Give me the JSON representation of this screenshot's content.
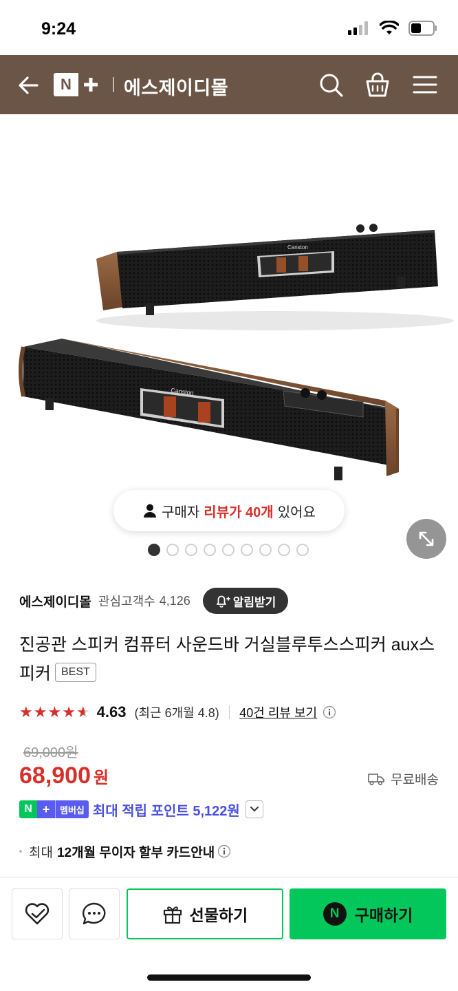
{
  "status_bar": {
    "time": "9:24"
  },
  "header": {
    "logo_n": "N",
    "store_name": "에스제이디몰",
    "colors": {
      "background": "#6b5546"
    }
  },
  "gallery": {
    "brand_text": "Canston",
    "review_pill": {
      "prefix": "구매자",
      "highlight": "리뷰가 40개",
      "suffix": "있어요"
    },
    "dots_total": 9,
    "active_dot": 1
  },
  "store": {
    "name": "에스제이디몰",
    "fans_label": "관심고객수",
    "fans_count": "4,126",
    "alert_button": "알림받기"
  },
  "product": {
    "title": "진공관 스피커 컴퓨터 사운드바 거실블루투스스피커 aux스피커",
    "badge": "BEST",
    "rating": "4.63",
    "recent_rating": "(최근 6개월 4.8)",
    "review_link": "40건 리뷰 보기",
    "original_price": "69,000원",
    "price": "68,900",
    "price_unit": "원",
    "shipping": "무료배송",
    "member_badge": {
      "n": "N",
      "plus": "+",
      "label": "멤버십"
    },
    "points_text": "최대 적립 포인트 5,122원",
    "installment": {
      "prefix": "최대",
      "bold": "12개월 무이자 할부 카드안내"
    }
  },
  "bottom_bar": {
    "gift_label": "선물하기",
    "buy_label": "구매하기",
    "buy_logo": "N"
  },
  "colors": {
    "accent_red": "#d7302a",
    "naver_green": "#03c75a",
    "membership_purple": "#5a5cf0"
  }
}
